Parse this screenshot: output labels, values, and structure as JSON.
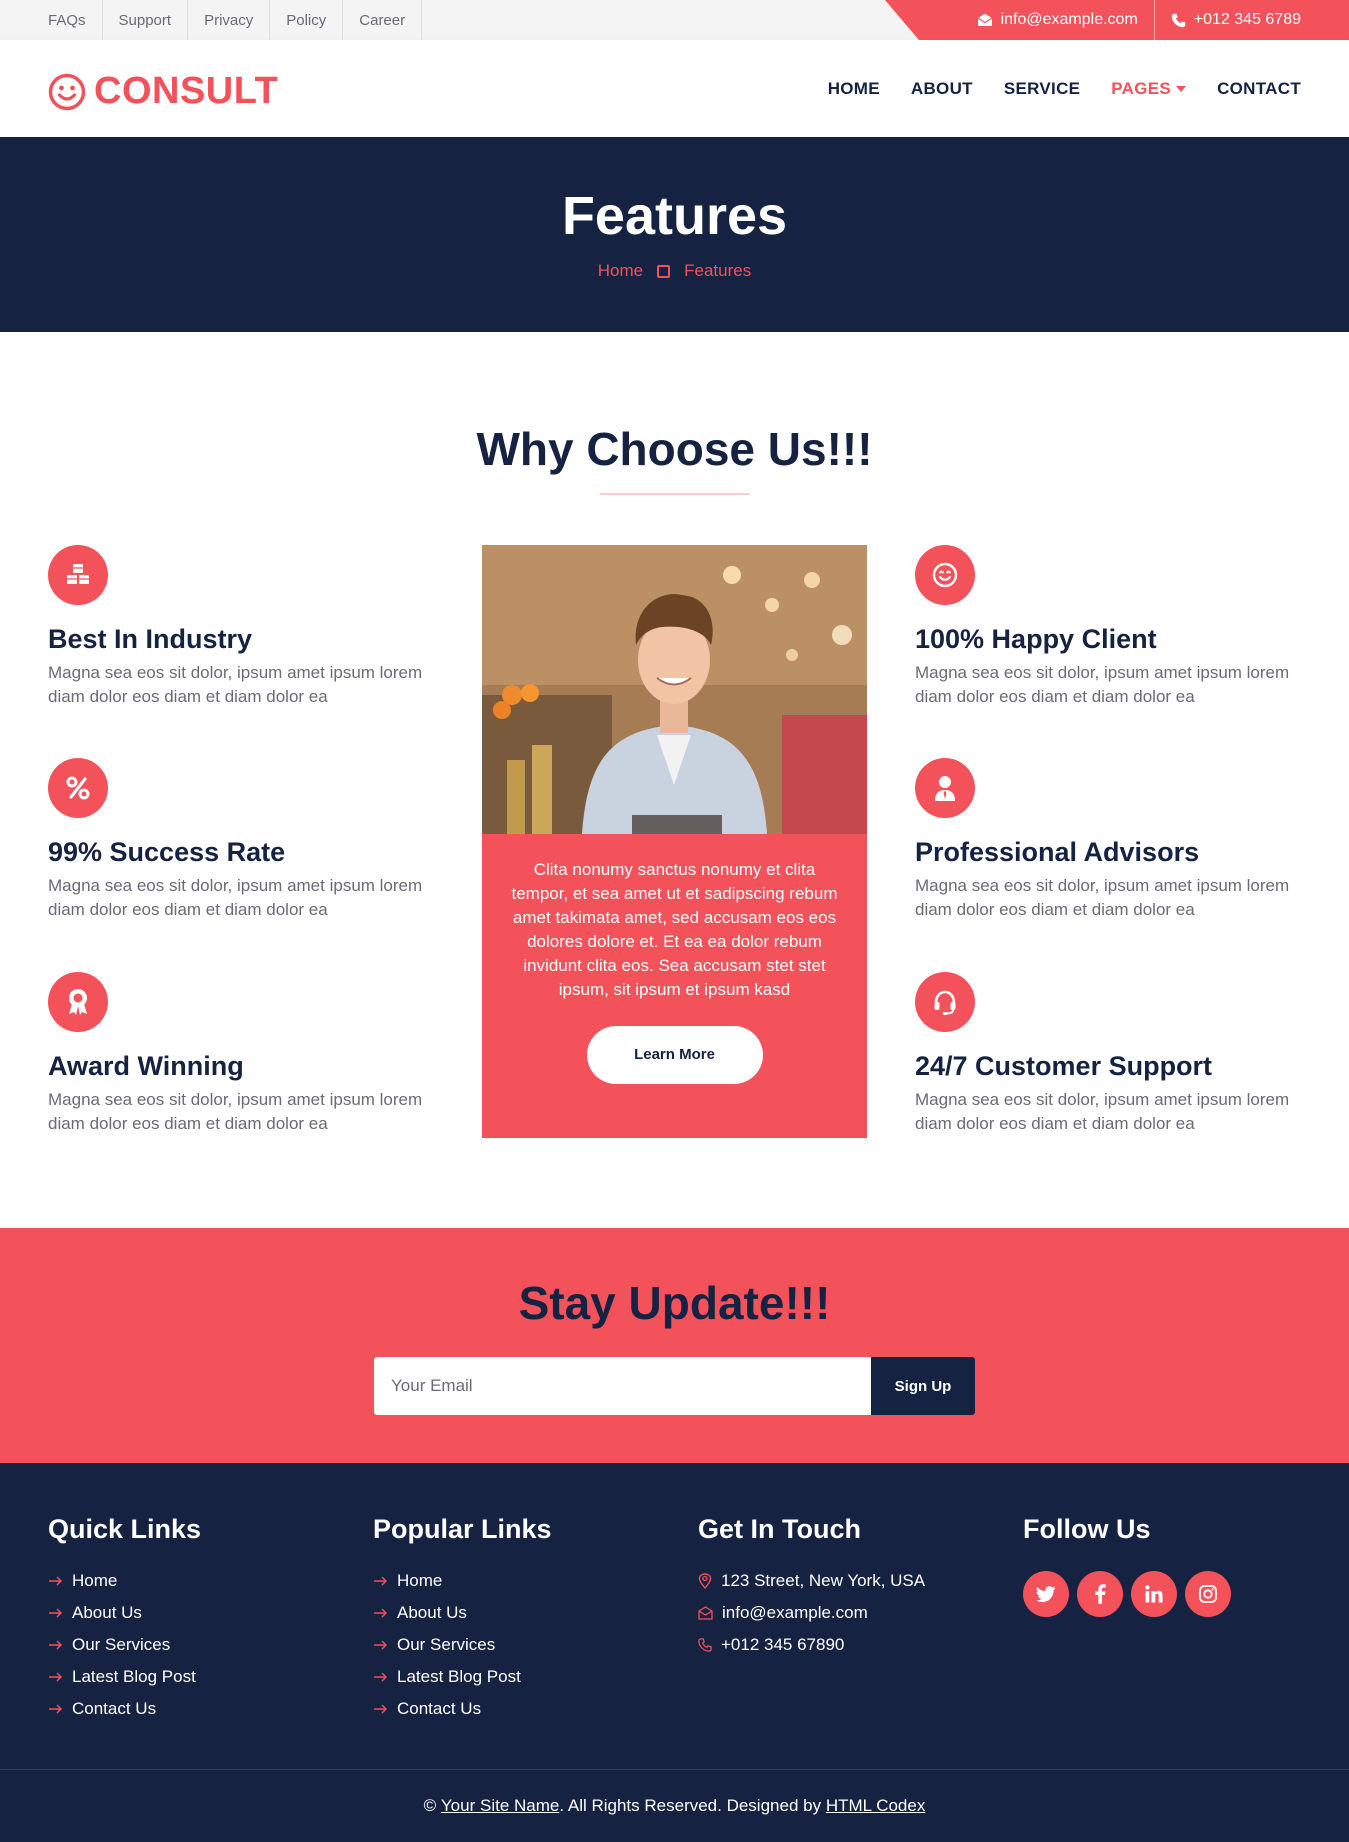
{
  "topbar": {
    "links": [
      "FAQs",
      "Support",
      "Privacy",
      "Policy",
      "Career"
    ],
    "email": "info@example.com",
    "phone": "+012 345 6789"
  },
  "brand": {
    "name": "CONSULT",
    "icon": "smile-icon"
  },
  "nav": {
    "items": [
      "HOME",
      "ABOUT",
      "SERVICE",
      "PAGES",
      "CONTACT"
    ],
    "active": "PAGES"
  },
  "page_header": {
    "title": "Features",
    "breadcrumb": [
      "Home",
      "Features"
    ]
  },
  "why_choose": {
    "title": "Why Choose Us!!!",
    "features": [
      {
        "icon": "cubes-icon",
        "title": "Best In Industry",
        "text": "Magna sea eos sit dolor, ipsum amet ipsum lorem diam dolor eos diam et diam dolor ea"
      },
      {
        "icon": "percent-icon",
        "title": "99% Success Rate",
        "text": "Magna sea eos sit dolor, ipsum amet ipsum lorem diam dolor eos diam et diam dolor ea"
      },
      {
        "icon": "award-icon",
        "title": "Award Winning",
        "text": "Magna sea eos sit dolor, ipsum amet ipsum lorem diam dolor eos diam et diam dolor ea"
      },
      {
        "icon": "smile-icon",
        "title": "100% Happy Client",
        "text": "Magna sea eos sit dolor, ipsum amet ipsum lorem diam dolor eos diam et diam dolor ea"
      },
      {
        "icon": "user-tie-icon",
        "title": "Professional Advisors",
        "text": "Magna sea eos sit dolor, ipsum amet ipsum lorem diam dolor eos diam et diam dolor ea"
      },
      {
        "icon": "headset-icon",
        "title": "24/7 Customer Support",
        "text": "Magna sea eos sit dolor, ipsum amet ipsum lorem diam dolor eos diam et diam dolor ea"
      }
    ],
    "card": {
      "text": "Clita nonumy sanctus nonumy et clita tempor, et sea amet ut et sadipscing rebum amet takimata amet, sed accusam eos eos dolores dolore et. Et ea ea dolor rebum invidunt clita eos. Sea accusam stet stet ipsum, sit ipsum et ipsum kasd",
      "button": "Learn More"
    }
  },
  "newsletter": {
    "title": "Stay Update!!!",
    "placeholder": "Your Email",
    "button": "Sign Up"
  },
  "footer": {
    "quick_links": {
      "title": "Quick Links",
      "items": [
        "Home",
        "About Us",
        "Our Services",
        "Latest Blog Post",
        "Contact Us"
      ]
    },
    "popular_links": {
      "title": "Popular Links",
      "items": [
        "Home",
        "About Us",
        "Our Services",
        "Latest Blog Post",
        "Contact Us"
      ]
    },
    "contact": {
      "title": "Get In Touch",
      "address": "123 Street, New York, USA",
      "email": "info@example.com",
      "phone": "+012 345 67890"
    },
    "follow": {
      "title": "Follow Us",
      "socials": [
        "twitter-icon",
        "facebook-icon",
        "linkedin-icon",
        "instagram-icon"
      ]
    },
    "copyright": {
      "prefix": "©",
      "site": "Your Site Name",
      "middle": ". All Rights Reserved. Designed by",
      "designer": "HTML Codex"
    }
  },
  "colors": {
    "accent": "#f3525a",
    "dark": "#152242",
    "text": "#6b6a75"
  }
}
